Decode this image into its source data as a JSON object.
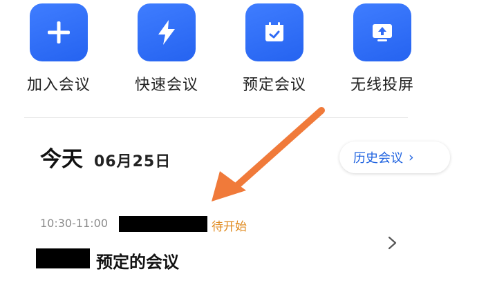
{
  "actions": [
    {
      "label": "加入会议",
      "icon": "plus-icon"
    },
    {
      "label": "快速会议",
      "icon": "lightning-icon"
    },
    {
      "label": "预定会议",
      "icon": "calendar-check-icon"
    },
    {
      "label": "无线投屏",
      "icon": "screen-cast-icon"
    }
  ],
  "today": {
    "word": "今天",
    "date": "06月25日"
  },
  "history_button": {
    "label": "历史会议",
    "chevron": "›"
  },
  "meeting": {
    "time": "10:30-11:00",
    "status": "待开始",
    "title": "预定的会议"
  },
  "colors": {
    "accent": "#2F6BF5",
    "status": "#E08A1E",
    "arrow": "#F07A3A"
  }
}
